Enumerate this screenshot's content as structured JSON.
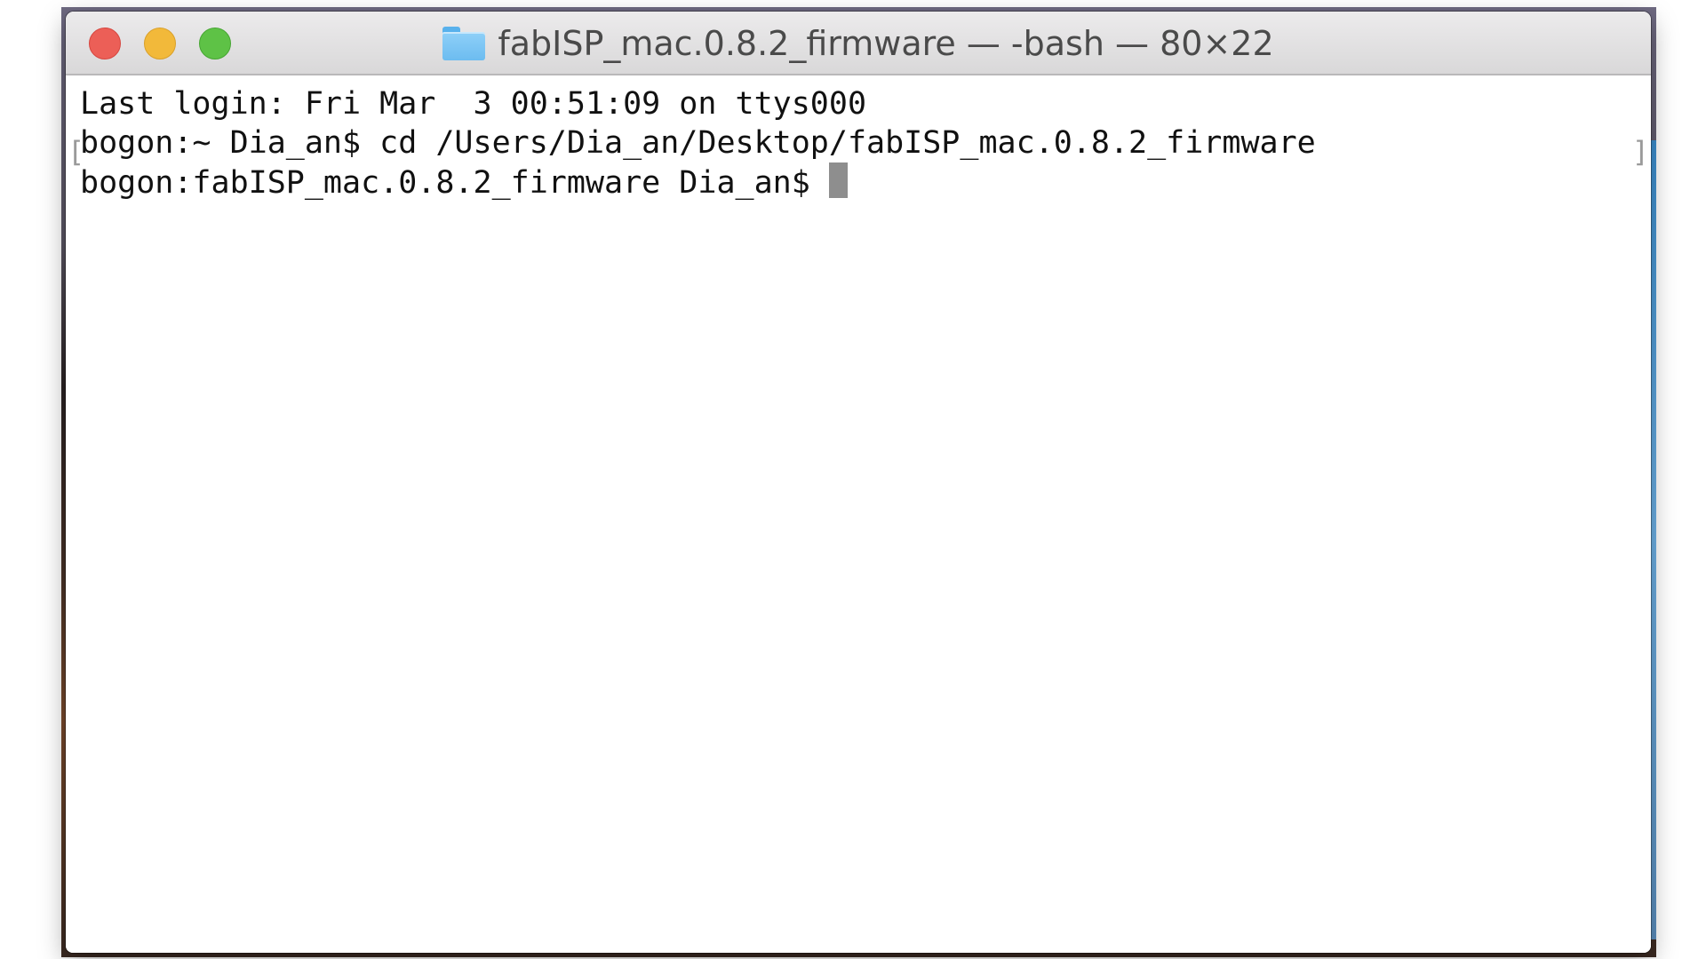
{
  "window": {
    "title": "fabISP_mac.0.8.2_firmware — -bash — 80×22",
    "title_icon": "folder-icon",
    "buttons": {
      "close": "close-button",
      "minimize": "minimize-button",
      "zoom": "zoom-button"
    }
  },
  "terminal": {
    "lines": [
      "Last login: Fri Mar  3 00:51:09 on ttys000",
      "bogon:~ Dia_an$ cd /Users/Dia_an/Desktop/fabISP_mac.0.8.2_firmware",
      "bogon:fabISP_mac.0.8.2_firmware Dia_an$ "
    ],
    "mark_left": "[",
    "mark_right": "]"
  },
  "colors": {
    "close": "#ec5f57",
    "minimize": "#f2b93a",
    "zoom": "#5ec246",
    "cursor": "#8e8e8e"
  }
}
